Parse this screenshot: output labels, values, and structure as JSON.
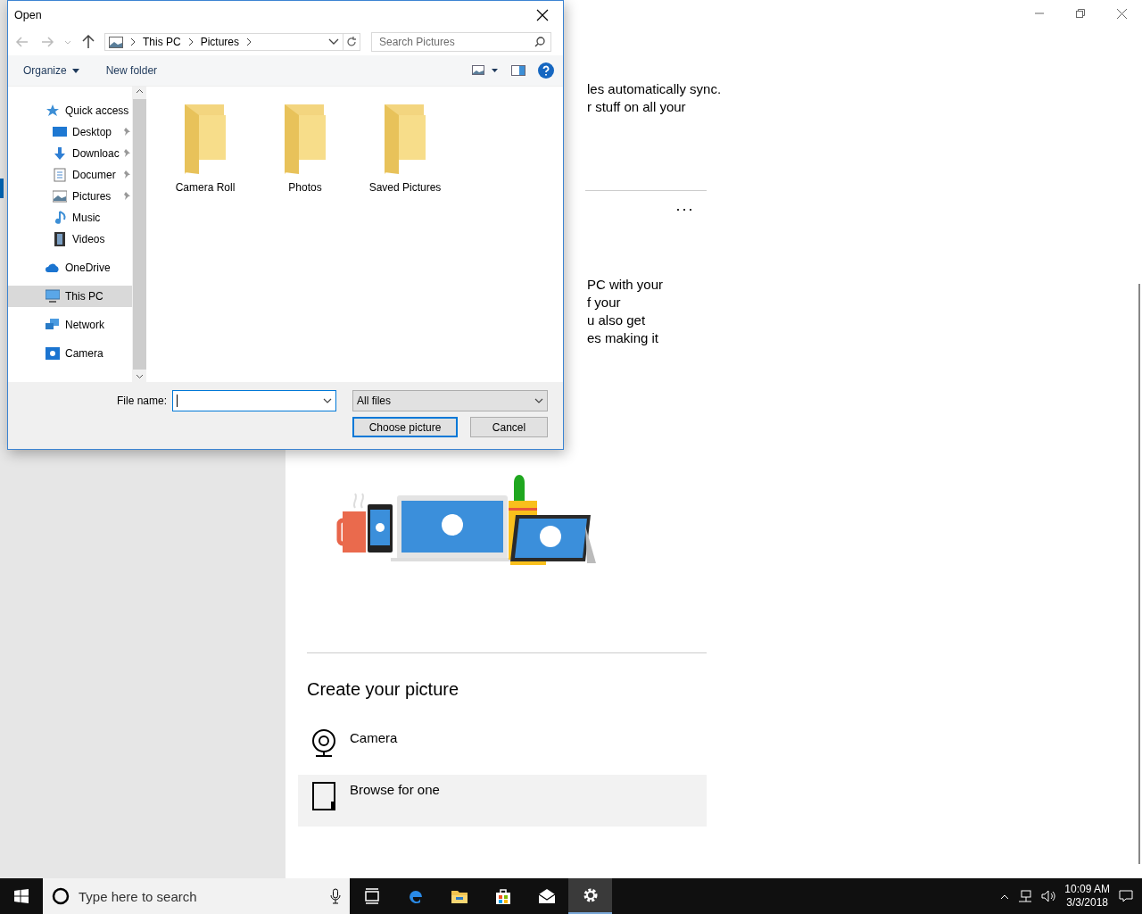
{
  "settings": {
    "text_block_1": [
      "les automatically sync.",
      "r stuff on all your"
    ],
    "more": "···",
    "text_block_2": [
      "PC with your",
      "f your",
      "u also get",
      "es making it"
    ],
    "create_heading": "Create your picture",
    "options": [
      {
        "label": "Camera",
        "kind": "camera",
        "selected": false
      },
      {
        "label": "Browse for one",
        "kind": "browse",
        "selected": true
      }
    ]
  },
  "dialog": {
    "title": "Open",
    "breadcrumb": [
      "This PC",
      "Pictures"
    ],
    "search": {
      "placeholder": "Search Pictures"
    },
    "toolbar": [
      "Organize",
      "New folder"
    ],
    "nav": [
      {
        "label": "Quick access",
        "kind": "star",
        "selected": false,
        "children": [
          {
            "label": "Desktop",
            "kind": "desktop",
            "pinned": true,
            "selected": false
          },
          {
            "label": "Downloac",
            "kind": "download",
            "pinned": true,
            "selected": false
          },
          {
            "label": "Documer",
            "kind": "document",
            "pinned": true,
            "selected": false
          },
          {
            "label": "Pictures",
            "kind": "pictures",
            "pinned": true,
            "selected": false
          },
          {
            "label": "Music",
            "kind": "music",
            "pinned": false,
            "selected": false
          },
          {
            "label": "Videos",
            "kind": "videos",
            "pinned": false,
            "selected": false
          }
        ]
      },
      {
        "label": "OneDrive",
        "kind": "cloud",
        "selected": false
      },
      {
        "label": "This PC",
        "kind": "pc",
        "selected": true
      },
      {
        "label": "Network",
        "kind": "network",
        "selected": false
      },
      {
        "label": "Camera",
        "kind": "camera",
        "selected": false
      }
    ],
    "folders": [
      "Camera Roll",
      "Photos",
      "Saved Pictures"
    ],
    "file_name_label": "File name:",
    "file_type": "All files",
    "buttons": [
      {
        "label": "Choose picture",
        "default": true
      },
      {
        "label": "Cancel",
        "default": false
      }
    ]
  },
  "taskbar": {
    "search_placeholder": "Type here to search",
    "apps": [
      {
        "kind": "taskview",
        "selected": false
      },
      {
        "kind": "edge",
        "selected": false
      },
      {
        "kind": "explorer",
        "selected": false
      },
      {
        "kind": "store",
        "selected": false
      },
      {
        "kind": "mail",
        "selected": false
      },
      {
        "kind": "settings",
        "selected": true
      }
    ],
    "time": "10:09 AM",
    "date": "3/3/2018"
  }
}
